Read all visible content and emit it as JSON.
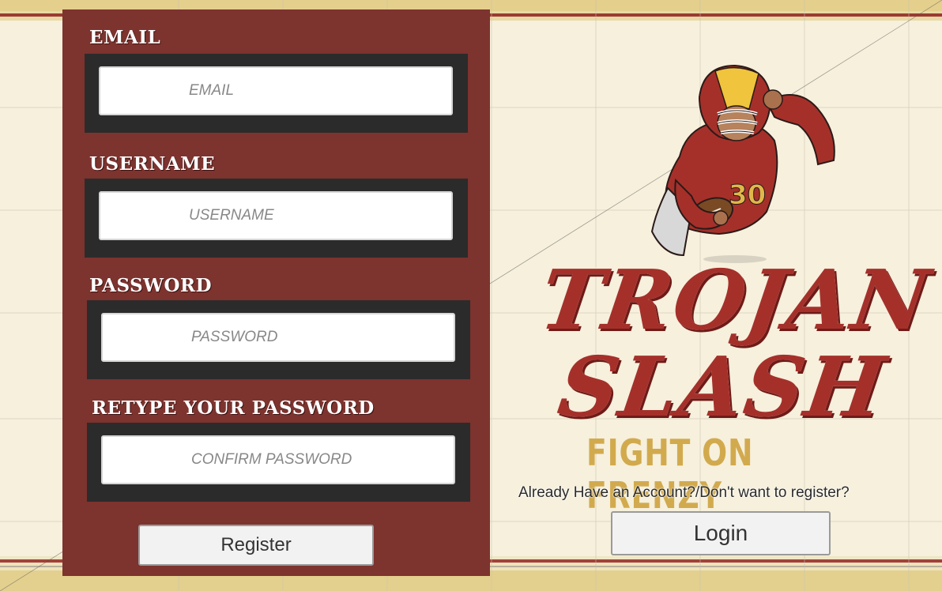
{
  "register_form": {
    "email": {
      "label": "EMAIL",
      "placeholder": "EMAIL"
    },
    "username": {
      "label": "USERNAME",
      "placeholder": "USERNAME"
    },
    "password": {
      "label": "PASSWORD",
      "placeholder": "PASSWORD"
    },
    "confirm": {
      "label": "RETYPE YOUR PASSWORD",
      "placeholder": "CONFIRM PASSWORD"
    },
    "register_label": "Register"
  },
  "branding": {
    "title_line1": "TROJAN",
    "title_line2": "SLASH",
    "subtitle": "FIGHT ON FRENZY",
    "player_jersey_number": "30",
    "player_icon": "football-player-illustration"
  },
  "login_section": {
    "prompt": "Already Have an Account?/Don't want to register?",
    "login_label": "Login"
  },
  "colors": {
    "panel": "#7d332e",
    "field_frame": "#2b2b2b",
    "title_red": "#a5302a",
    "gold": "#d2aa4e",
    "background": "#f6f0dc"
  }
}
